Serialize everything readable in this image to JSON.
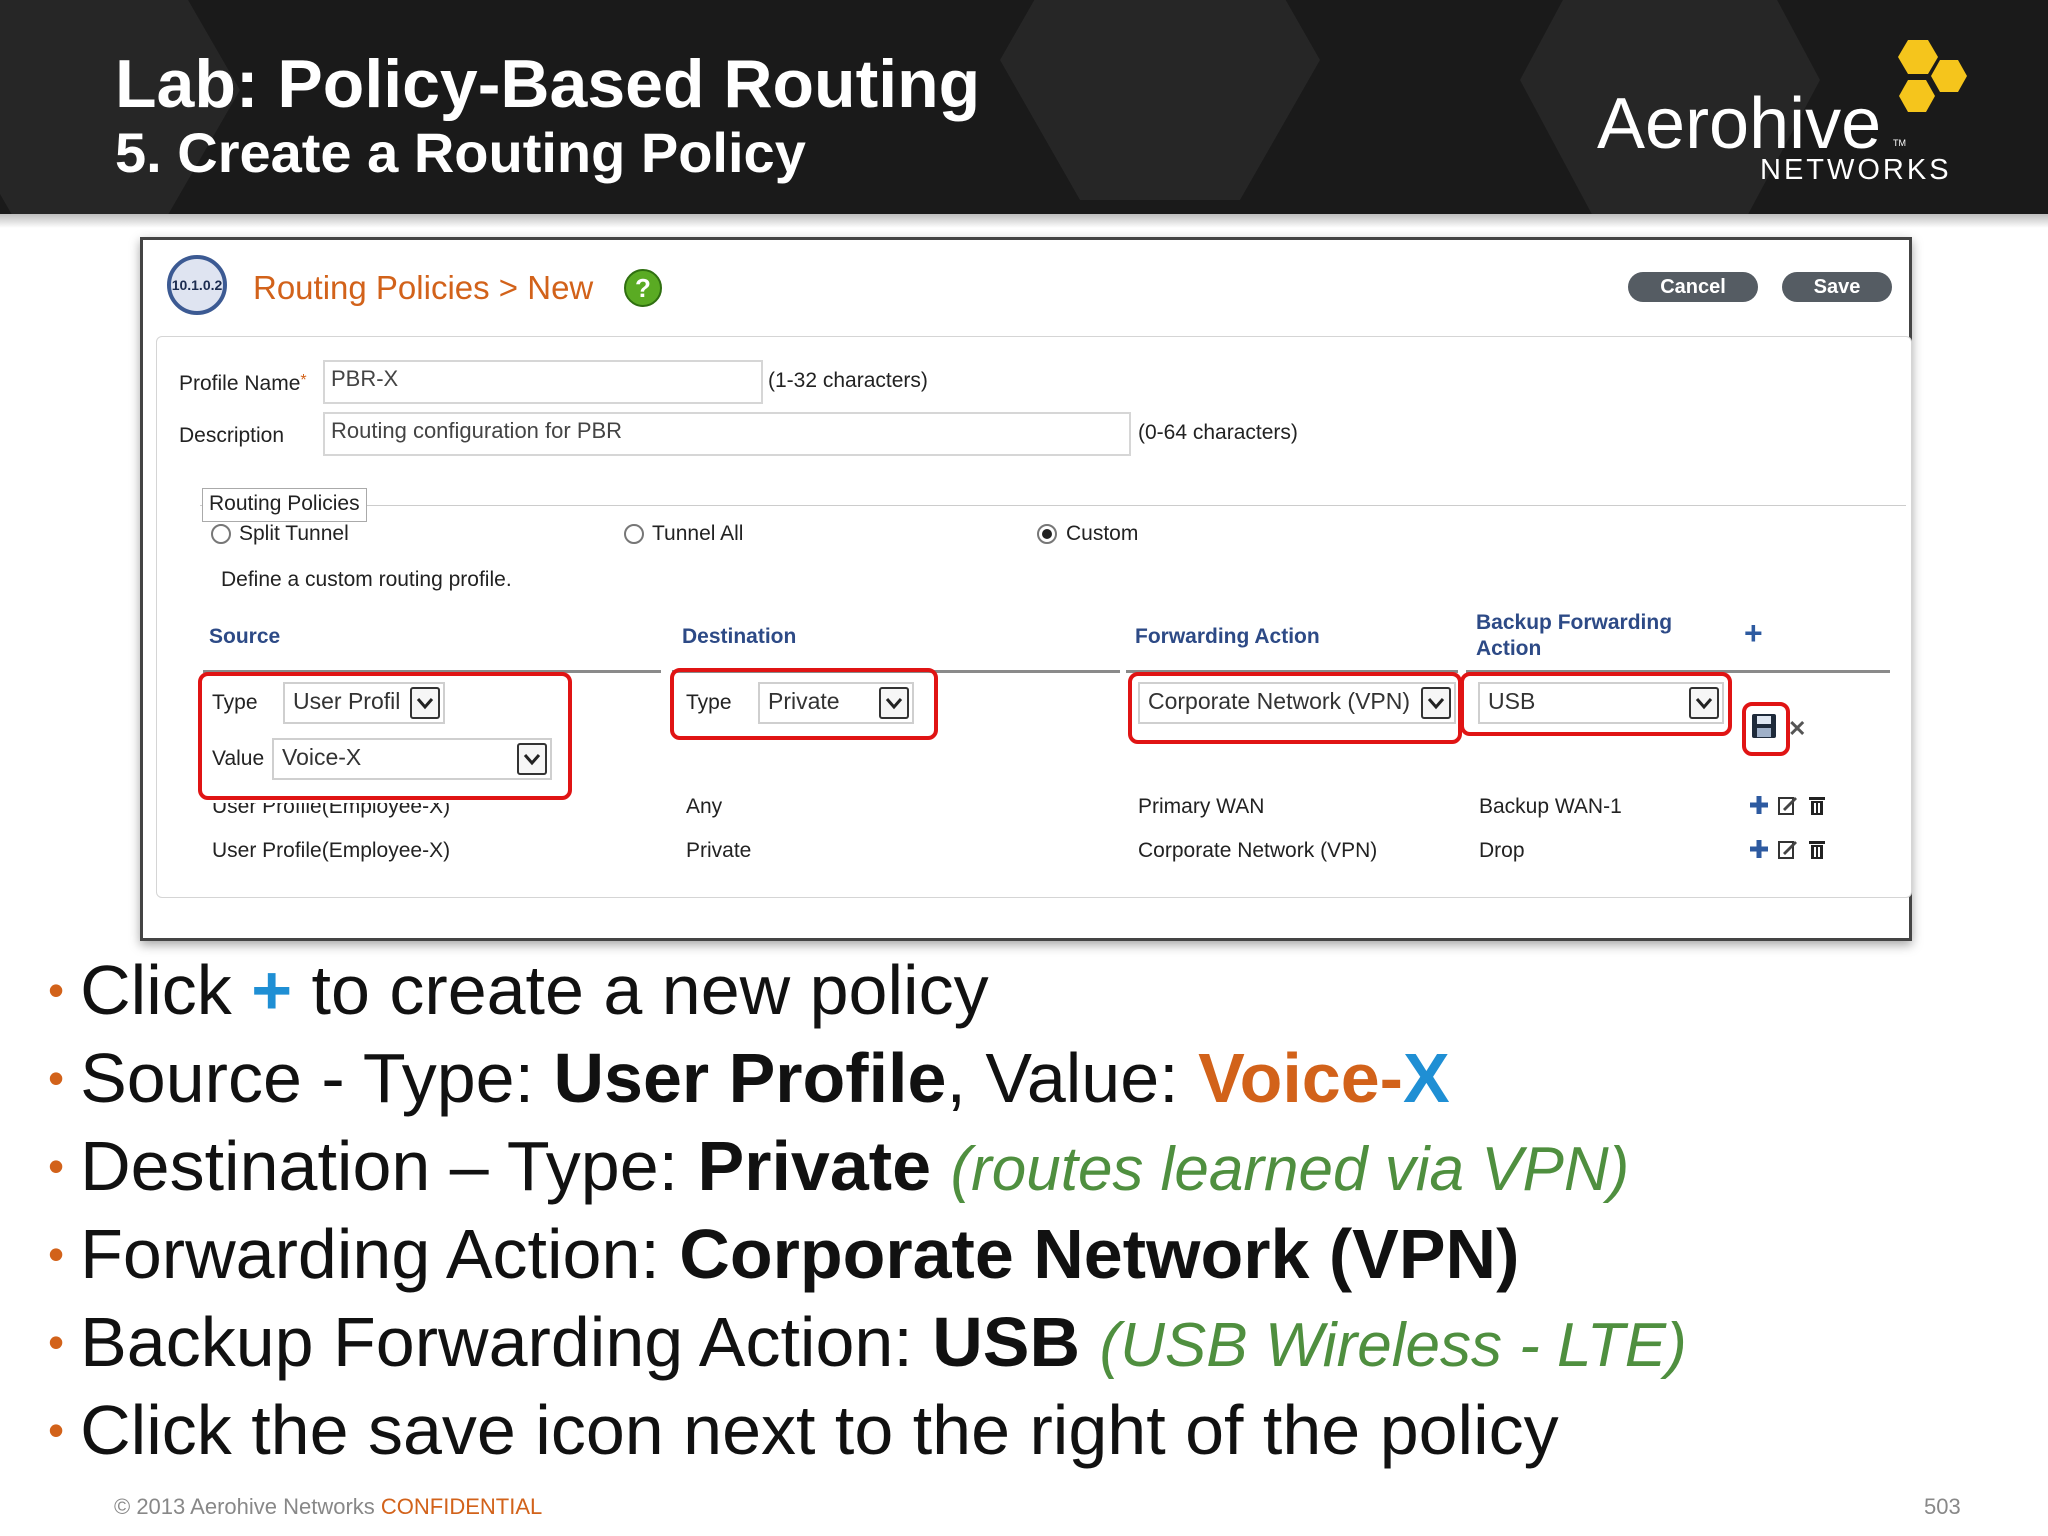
{
  "slide": {
    "title": "Lab: Policy-Based Routing",
    "subtitle": "5. Create a Routing Policy",
    "logo": {
      "name": "Aerohive",
      "tm": "TM",
      "sub": "NETWORKS"
    }
  },
  "app": {
    "ip_badge": "10.1.0.2",
    "page_heading": "Routing Policies > New",
    "help_icon": "?",
    "cancel_label": "Cancel",
    "save_label": "Save"
  },
  "form": {
    "profile_name_label": "Profile Name",
    "profile_name_required": "*",
    "profile_name_value": "PBR-X",
    "profile_name_hint": "(1-32 characters)",
    "description_label": "Description",
    "description_value": "Routing configuration for PBR",
    "description_hint": "(0-64 characters)",
    "routing_policies_legend": "Routing Policies",
    "options": [
      "Split Tunnel",
      "Tunnel All",
      "Custom"
    ],
    "selected_option": "Custom",
    "custom_note": "Define a custom routing profile."
  },
  "policy_table": {
    "headers": {
      "source": "Source",
      "destination": "Destination",
      "forwarding": "Forwarding Action",
      "backup_line1": "Backup Forwarding",
      "backup_line2": "Action"
    },
    "editor": {
      "source_type_label": "Type",
      "source_type_value": "User Profil",
      "source_value_label": "Value",
      "source_value_value": "Voice-X",
      "dest_type_label": "Type",
      "dest_type_value": "Private",
      "forwarding_value": "Corporate Network (VPN)",
      "backup_value": "USB"
    },
    "rows": [
      {
        "source": "User Profile(Employee-X)",
        "destination": "Any",
        "forwarding": "Primary WAN",
        "backup": "Backup WAN-1"
      },
      {
        "source": "User Profile(Employee-X)",
        "destination": "Private",
        "forwarding": "Corporate Network (VPN)",
        "backup": "Drop"
      }
    ]
  },
  "bullets": {
    "b1": {
      "pre": "Click ",
      "plus": "+",
      "post": " to create a new policy"
    },
    "b2": {
      "pre": "Source - Type: ",
      "bold": "User Profile",
      "mid": ", Value: ",
      "voice": "Voice-",
      "x": "X"
    },
    "b3": {
      "pre": "Destination – Type: ",
      "bold": "Private",
      "note": "(routes learned via VPN)"
    },
    "b4": {
      "pre": "Forwarding Action: ",
      "bold": "Corporate Network (VPN)"
    },
    "b5": {
      "pre": "Backup Forwarding Action: ",
      "bold": "USB",
      "note": "(USB Wireless - LTE)"
    },
    "b6": {
      "text": "Click the save icon next to the right of the policy"
    },
    "dot": "•"
  },
  "footer": {
    "copyright": "© 2013 Aerohive Networks ",
    "confidential": "CONFIDENTIAL",
    "page_number": "503"
  },
  "colors": {
    "accent_orange": "#d2621a",
    "accent_blue": "#1f8fd4",
    "highlight_red": "#e01414",
    "note_green": "#4f8f3f",
    "banner_black": "#1a1a1a",
    "logo_yellow": "#f5c51c"
  },
  "icons": [
    "hexagon-logo-icon",
    "help-icon",
    "radio-icon",
    "dropdown-arrow-icon",
    "add-icon",
    "save-icon",
    "close-icon",
    "edit-icon",
    "trash-icon"
  ]
}
